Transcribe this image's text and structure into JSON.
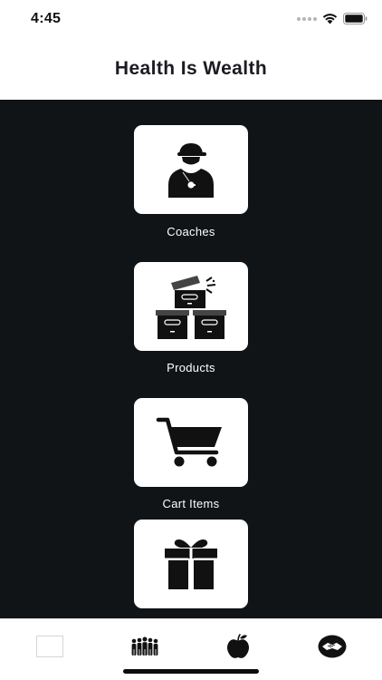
{
  "status_bar": {
    "time": "4:45",
    "icons": [
      "signal-dots",
      "wifi-icon",
      "battery-icon"
    ]
  },
  "header": {
    "title": "Health Is Wealth"
  },
  "menu": {
    "items": [
      {
        "label": "Coaches",
        "icon": "coach-icon"
      },
      {
        "label": "Products",
        "icon": "boxes-icon"
      },
      {
        "label": "Cart Items",
        "icon": "cart-icon"
      },
      {
        "label": "",
        "icon": "gift-icon"
      }
    ]
  },
  "tab_bar": {
    "tabs": [
      {
        "icon": "blank-tab-icon"
      },
      {
        "icon": "group-icon"
      },
      {
        "icon": "apple-icon"
      },
      {
        "icon": "handshake-icon"
      }
    ]
  },
  "colors": {
    "background": "#101417",
    "tile": "#ffffff",
    "label": "#ffffff",
    "title": "#1b1b22"
  }
}
